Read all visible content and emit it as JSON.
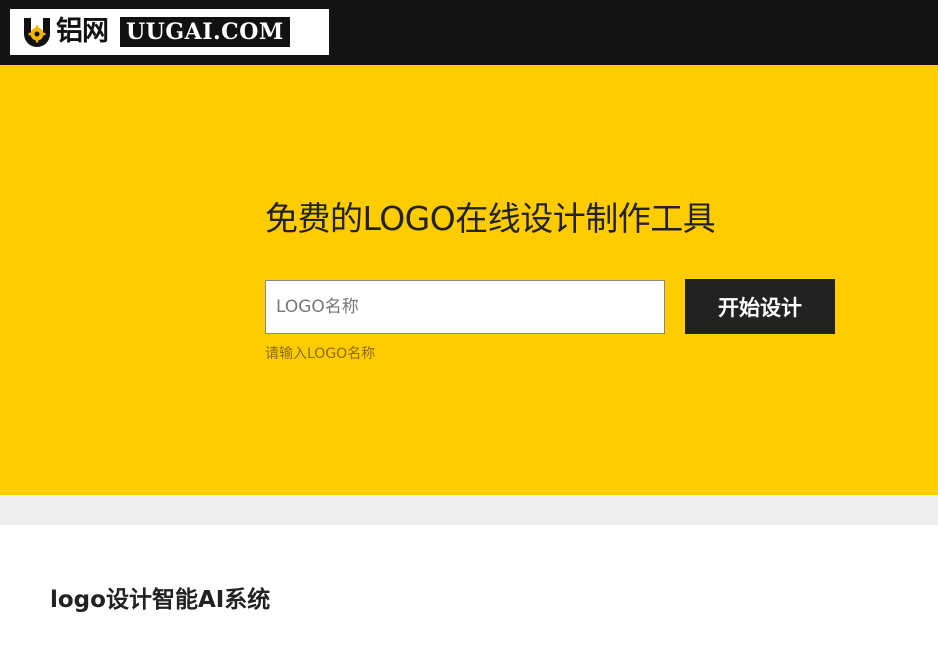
{
  "header": {
    "logo_cn": "铝网",
    "logo_en": "UUGAI.COM"
  },
  "hero": {
    "title": "免费的LOGO在线设计制作工具",
    "input_placeholder": "LOGO名称",
    "input_value": "",
    "start_button": "开始设计",
    "input_hint": "请输入LOGO名称"
  },
  "section": {
    "title": "logo设计智能AI系统"
  },
  "colors": {
    "topbar": "#141414",
    "hero_bg": "#ffcc00",
    "button_bg": "#222222",
    "strip_bg": "#efefef"
  },
  "icons": {
    "logo_mark": "u-gear-logo-icon"
  }
}
